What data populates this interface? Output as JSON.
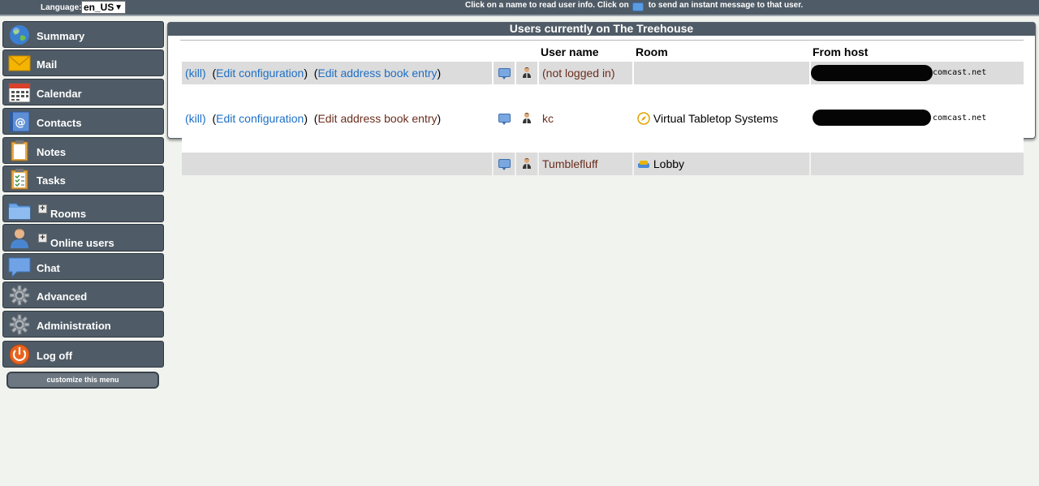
{
  "topbar": {
    "language_label": "Language:",
    "language_value": "en_US",
    "hint_before": "Click on a name to read user info. Click on",
    "hint_after": "to send an instant message to that user."
  },
  "sidebar": {
    "items": [
      {
        "label": "Summary",
        "icon": "globe-icon"
      },
      {
        "label": "Mail",
        "icon": "envelope-icon"
      },
      {
        "label": "Calendar",
        "icon": "calendar-icon"
      },
      {
        "label": "Contacts",
        "icon": "address-book-icon"
      },
      {
        "label": "Notes",
        "icon": "notepad-icon"
      },
      {
        "label": "Tasks",
        "icon": "clipboard-checklist-icon"
      },
      {
        "label": "Rooms",
        "icon": "folder-icon",
        "expander": "+"
      },
      {
        "label": "Online users",
        "icon": "user-icon",
        "expander": "+"
      },
      {
        "label": "Chat",
        "icon": "speech-bubble-icon"
      },
      {
        "label": "Advanced",
        "icon": "gear-icon"
      },
      {
        "label": "Administration",
        "icon": "gear-icon"
      },
      {
        "label": "Log off",
        "icon": "power-icon"
      }
    ],
    "customize_label": "customize this menu"
  },
  "panel": {
    "title": "Users currently on The Treehouse",
    "columns": {
      "user": "User name",
      "room": "Room",
      "host": "From host"
    },
    "rows": [
      {
        "kill": "kill",
        "edit_config": "Edit configuration",
        "edit_addr": "Edit address book entry",
        "user": "(not logged in)",
        "room": "",
        "host": "comcast.net"
      },
      {
        "kill": "kill",
        "edit_config": "Edit configuration",
        "edit_addr": "Edit address book entry",
        "user": "kc",
        "room": "Virtual Tabletop Systems",
        "host": "comcast.net"
      },
      {
        "user": "Tumblefluff",
        "room": "Lobby",
        "host": ""
      }
    ]
  },
  "colors": {
    "bar": "#4f5b66",
    "link": "#1e6fc5",
    "visited": "#6b2e1e",
    "row_alt": "#dcdcdc"
  }
}
